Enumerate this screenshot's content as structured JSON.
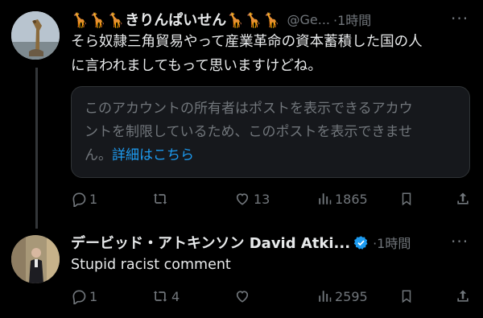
{
  "tweet1": {
    "display_name": "🦒🦒🦒きりんぱいせん🦒🦒🦒",
    "handle": "@Ge...",
    "time": "·1時間",
    "text_line1": "そら奴隷三角貿易やって産業革命の資本蓄積した国の人",
    "text_line2": "に言われましてもって思いますけどね。",
    "notice_line1": "このアカウントの所有者はポストを表示できるアカウ",
    "notice_line2": "ントを制限しているため、このポストを表示できませ",
    "notice_line3_prefix": "ん。",
    "notice_link": "詳細はこちら",
    "replies": "1",
    "reposts": "",
    "likes": "13",
    "views": "1865"
  },
  "tweet2": {
    "display_name": "デービッド・アトキンソン David Atki...",
    "time": "·1時間",
    "text": "Stupid racist comment",
    "replies": "1",
    "reposts": "4",
    "likes": "",
    "views": "2595"
  },
  "icons": {
    "more": "more-horizontal-icon",
    "reply": "reply-bubble-icon",
    "repost": "repost-arrows-icon",
    "like": "heart-icon",
    "views": "bar-chart-icon",
    "bookmark": "bookmark-icon",
    "share": "share-icon",
    "verified": "verified-badge-icon"
  },
  "colors": {
    "background": "#000000",
    "text": "#e7e9ea",
    "muted": "#71767b",
    "link": "#1d9bf0",
    "card": "#16181c"
  }
}
